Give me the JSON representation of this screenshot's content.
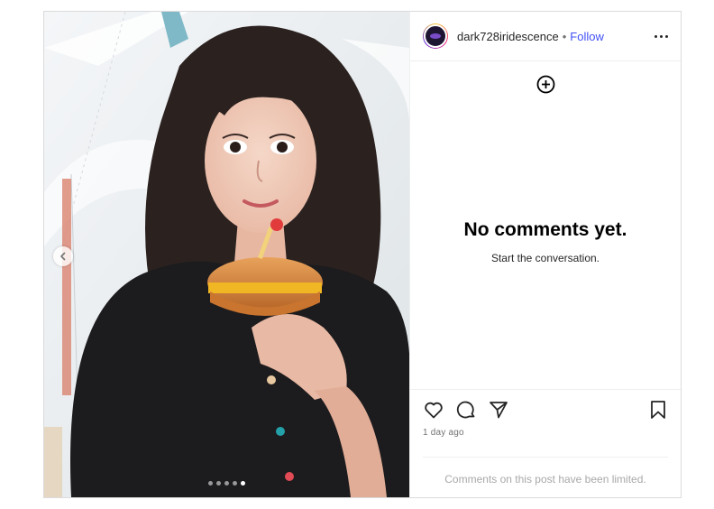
{
  "post": {
    "username": "dark728iridescence",
    "separator": "•",
    "follow_label": "Follow",
    "carousel": {
      "slide_count": 5,
      "active_index": 4
    }
  },
  "comments": {
    "empty_title": "No comments yet.",
    "empty_subtitle": "Start the conversation."
  },
  "actions": {
    "icons": [
      "heart-icon",
      "comment-icon",
      "share-icon",
      "bookmark-icon"
    ],
    "timestamp": "1 day ago",
    "limited_notice": "Comments on this post have been limited."
  },
  "colors": {
    "follow": "#4150f7",
    "border": "#dbdbdb",
    "muted": "#737373"
  }
}
